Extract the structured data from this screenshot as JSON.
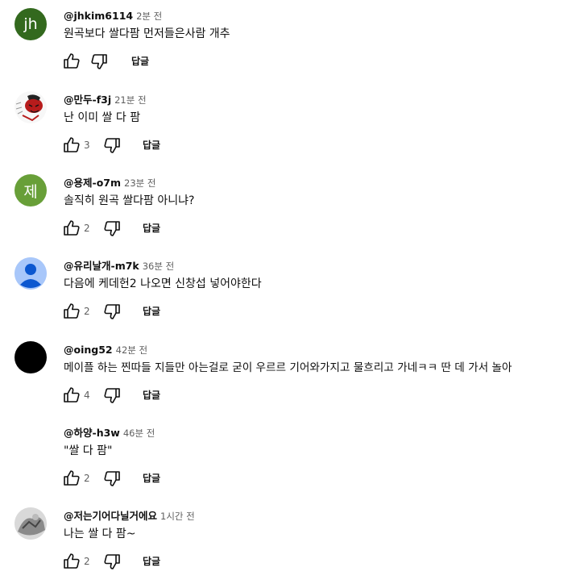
{
  "comments": [
    {
      "author": "@jhkim6114",
      "time": "2분 전",
      "text": "원곡보다 쌀다팜 먼저들은사람 개추",
      "likes": "",
      "reply_label": "답글",
      "avatar": {
        "type": "letter",
        "letter": "jh",
        "color": "#33691e"
      }
    },
    {
      "author": "@만두-f3j",
      "time": "21분 전",
      "text": "난 이미 쌀 다 팜",
      "likes": "3",
      "reply_label": "답글",
      "avatar": {
        "type": "image",
        "icon": "red-character-drawing"
      }
    },
    {
      "author": "@용제-o7m",
      "time": "23분 전",
      "text": "솔직히 원곡 쌀다팜 아니냐?",
      "likes": "2",
      "reply_label": "답글",
      "avatar": {
        "type": "letter",
        "letter": "제",
        "color": "#689f38"
      }
    },
    {
      "author": "@유리날개-m7k",
      "time": "36분 전",
      "text": "다음에 케데헌2 나오면 신창섭 넣어야한다",
      "likes": "2",
      "reply_label": "답글",
      "avatar": {
        "type": "default",
        "icon": "default-person"
      }
    },
    {
      "author": "@oing52",
      "time": "42분 전",
      "text": "메이플 하는 찐따들 지들만 아는걸로 굳이  우르르 기어와가지고 물흐리고 가네ㅋㅋ 딴 데 가서 놀아",
      "likes": "4",
      "reply_label": "답글",
      "avatar": {
        "type": "solid",
        "color": "#000000"
      }
    },
    {
      "author": "@하양-h3w",
      "time": "46분 전",
      "text": "\"쌀 다 팜\"",
      "likes": "2",
      "reply_label": "답글",
      "avatar": {
        "type": "none"
      }
    },
    {
      "author": "@저는기어다닐거에요",
      "time": "1시간 전",
      "text": "나는 쌀 다 팜~",
      "likes": "2",
      "reply_label": "답글",
      "avatar": {
        "type": "image",
        "icon": "gray-photo"
      }
    }
  ],
  "colors": {
    "muted": "#606060",
    "text": "#0f0f0f"
  }
}
